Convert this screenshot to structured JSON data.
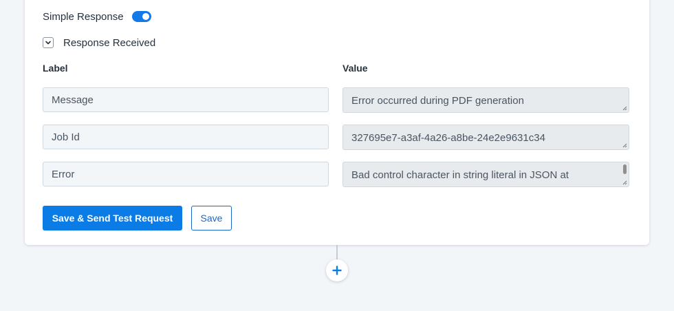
{
  "simple_response": {
    "label": "Simple Response",
    "enabled": true
  },
  "response_section": {
    "label": "Response Received",
    "expanded": true
  },
  "columns": {
    "label": "Label",
    "value": "Value"
  },
  "rows": [
    {
      "label": "Message",
      "value": "Error occurred during PDF generation"
    },
    {
      "label": "Job Id",
      "value": "327695e7-a3af-4a26-a8be-24e2e9631c34"
    },
    {
      "label": "Error",
      "value": "Bad control character in string literal in JSON at"
    }
  ],
  "buttons": {
    "send_test": "Save & Send Test Request",
    "save": "Save"
  },
  "colors": {
    "accent": "#0b7be6",
    "toggle_on": "#1479e8",
    "page_bg": "#f3f6f9"
  },
  "icons": {
    "collapse": "chevron-down-icon",
    "add_step": "plus-icon"
  }
}
